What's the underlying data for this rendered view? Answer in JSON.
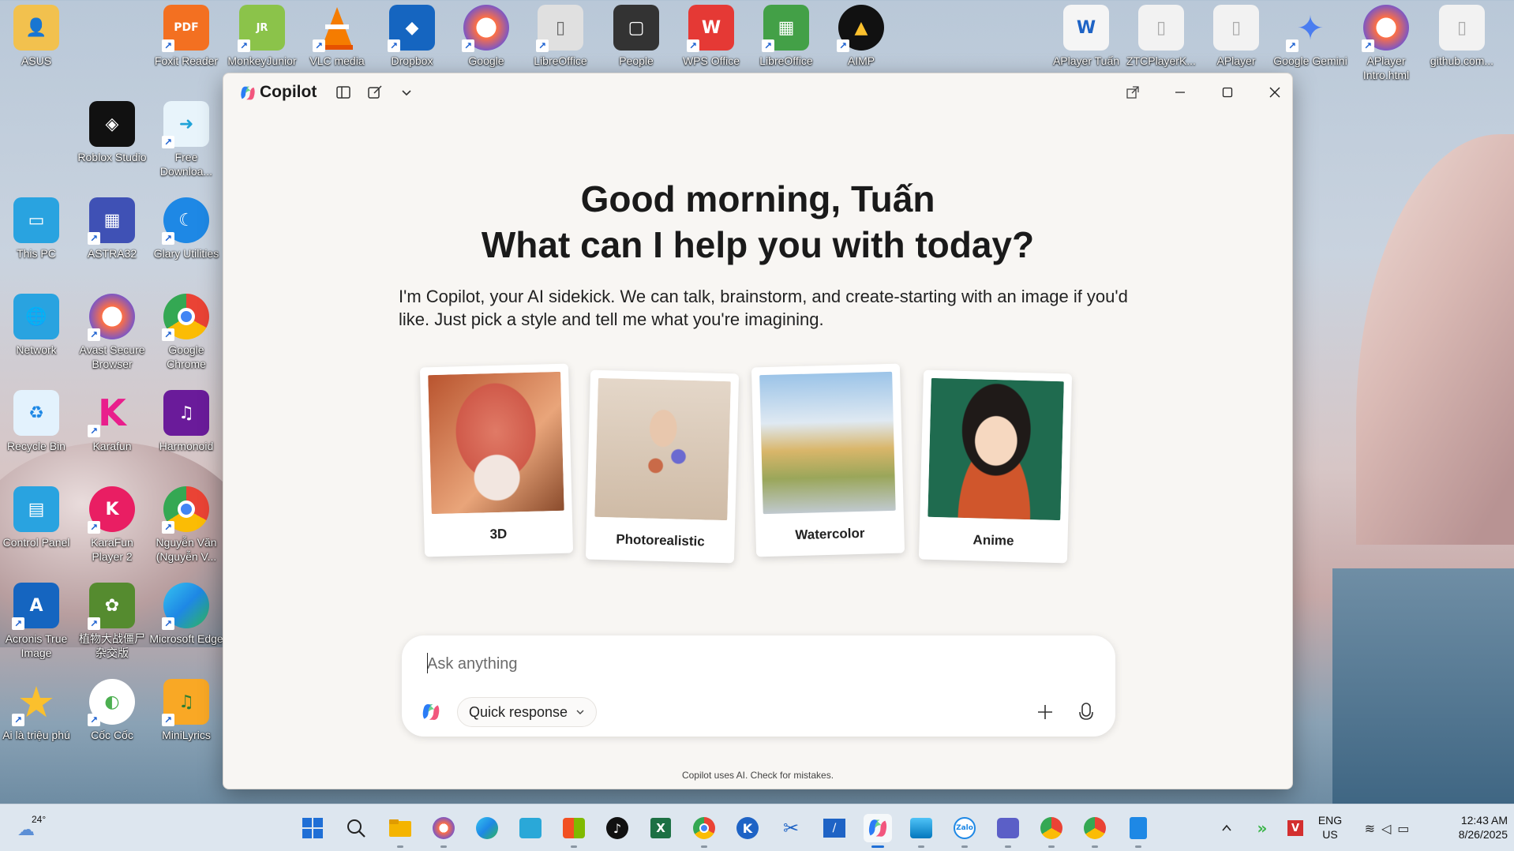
{
  "desktop": {
    "icons": [
      {
        "label": "ASUS"
      },
      {
        "label": "Foxit Reader"
      },
      {
        "label": "MonkeyJunior"
      },
      {
        "label": "VLC media"
      },
      {
        "label": "Dropbox"
      },
      {
        "label": "Google"
      },
      {
        "label": "LibreOffice"
      },
      {
        "label": "People"
      },
      {
        "label": "WPS Office"
      },
      {
        "label": "LibreOffice"
      },
      {
        "label": "AIMP"
      },
      {
        "label": "APlayer Tuấn"
      },
      {
        "label": "ZTCPlayerK..."
      },
      {
        "label": "APlayer"
      },
      {
        "label": "Google Gemini"
      },
      {
        "label": "APlayer Intro.html"
      },
      {
        "label": "github.com..."
      },
      {
        "label": "Roblox Studio"
      },
      {
        "label": "Free Downloa..."
      },
      {
        "label": "This PC"
      },
      {
        "label": "ASTRA32"
      },
      {
        "label": "Glary Utilities"
      },
      {
        "label": "Network"
      },
      {
        "label": "Avast Secure Browser"
      },
      {
        "label": "Google Chrome"
      },
      {
        "label": "Recycle Bin"
      },
      {
        "label": "Karafun"
      },
      {
        "label": "Harmonoid"
      },
      {
        "label": "Control Panel"
      },
      {
        "label": "KaraFun Player 2"
      },
      {
        "label": "Nguyễn Văn (Nguyễn V..."
      },
      {
        "label": "Acronis True Image"
      },
      {
        "label": "植物大战僵尸杂交版"
      },
      {
        "label": "Microsoft Edge"
      },
      {
        "label": "Ai là triệu phú"
      },
      {
        "label": "Cốc Cốc"
      },
      {
        "label": "MiniLyrics"
      }
    ]
  },
  "copilot": {
    "title": "Copilot",
    "greeting_line1": "Good morning, Tuấn",
    "greeting_line2": "What can I help you with today?",
    "intro": "I'm Copilot, your AI sidekick. We can talk, brainstorm, and create-starting with an image if you'd like. Just pick a style and tell me what you're imagining.",
    "styles": [
      {
        "label": "3D"
      },
      {
        "label": "Photorealistic"
      },
      {
        "label": "Watercolor"
      },
      {
        "label": "Anime"
      }
    ],
    "composer": {
      "placeholder": "Ask anything",
      "value": "",
      "mode_label": "Quick response"
    },
    "disclaimer": "Copilot uses AI. Check for mistakes."
  },
  "taskbar": {
    "weather_temp": "24°",
    "lang_top": "ENG",
    "lang_bottom": "US",
    "time": "12:43 AM",
    "date": "8/26/2025",
    "apps": [
      "start-icon",
      "search-icon",
      "file-explorer-icon",
      "avast-browser-icon",
      "edge-icon",
      "security-icon",
      "store-icon",
      "tiktok-icon",
      "excel-icon",
      "chrome-icon",
      "k-app-icon",
      "snipping-tool-icon",
      "pen-app-icon",
      "copilot-icon",
      "photos-icon",
      "zalo-icon",
      "teams-icon",
      "chrome-profile-icon",
      "chrome-profile2-icon",
      "notepad-icon"
    ]
  },
  "colors": {
    "accent": "#1f6fd6",
    "window_bg": "#f8f6f3",
    "text": "#1a1a1a"
  }
}
